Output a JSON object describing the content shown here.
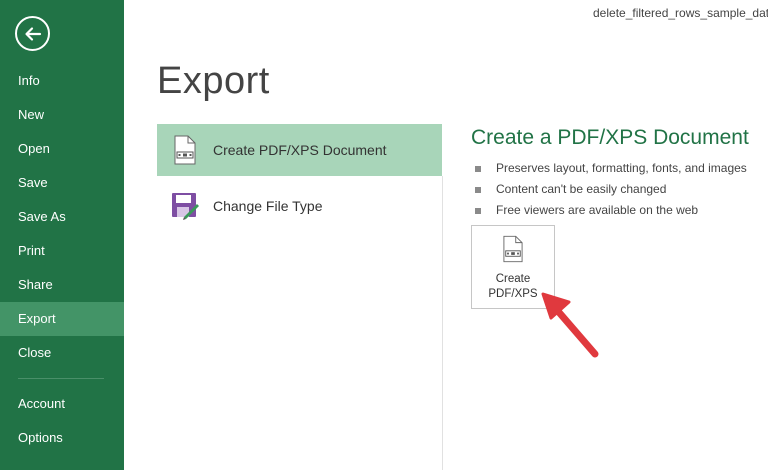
{
  "window": {
    "filename": "delete_filtered_rows_sample_dat"
  },
  "sidebar": {
    "back_icon": "back-arrow-icon",
    "items": [
      {
        "label": "Info"
      },
      {
        "label": "New"
      },
      {
        "label": "Open"
      },
      {
        "label": "Save"
      },
      {
        "label": "Save As"
      },
      {
        "label": "Print"
      },
      {
        "label": "Share"
      },
      {
        "label": "Export",
        "active": true
      },
      {
        "label": "Close"
      }
    ],
    "footer_items": [
      {
        "label": "Account"
      },
      {
        "label": "Options"
      }
    ]
  },
  "main": {
    "title": "Export",
    "options": [
      {
        "label": "Create PDF/XPS Document",
        "icon": "pdf-document-icon",
        "selected": true
      },
      {
        "label": "Change File Type",
        "icon": "change-file-type-icon",
        "selected": false
      }
    ]
  },
  "detail": {
    "title": "Create a PDF/XPS Document",
    "bullets": [
      "Preserves layout, formatting, fonts, and images",
      "Content can't be easily changed",
      "Free viewers are available on the web"
    ],
    "button": {
      "line1": "Create",
      "line2": "PDF/XPS",
      "icon": "pdf-document-icon"
    },
    "annotation": "red-arrow-icon"
  },
  "colors": {
    "sidebar_bg": "#217346",
    "sidebar_active": "#439467",
    "option_selected": "#a8d5b9",
    "accent_title": "#217346",
    "arrow_red": "#e0393e"
  }
}
